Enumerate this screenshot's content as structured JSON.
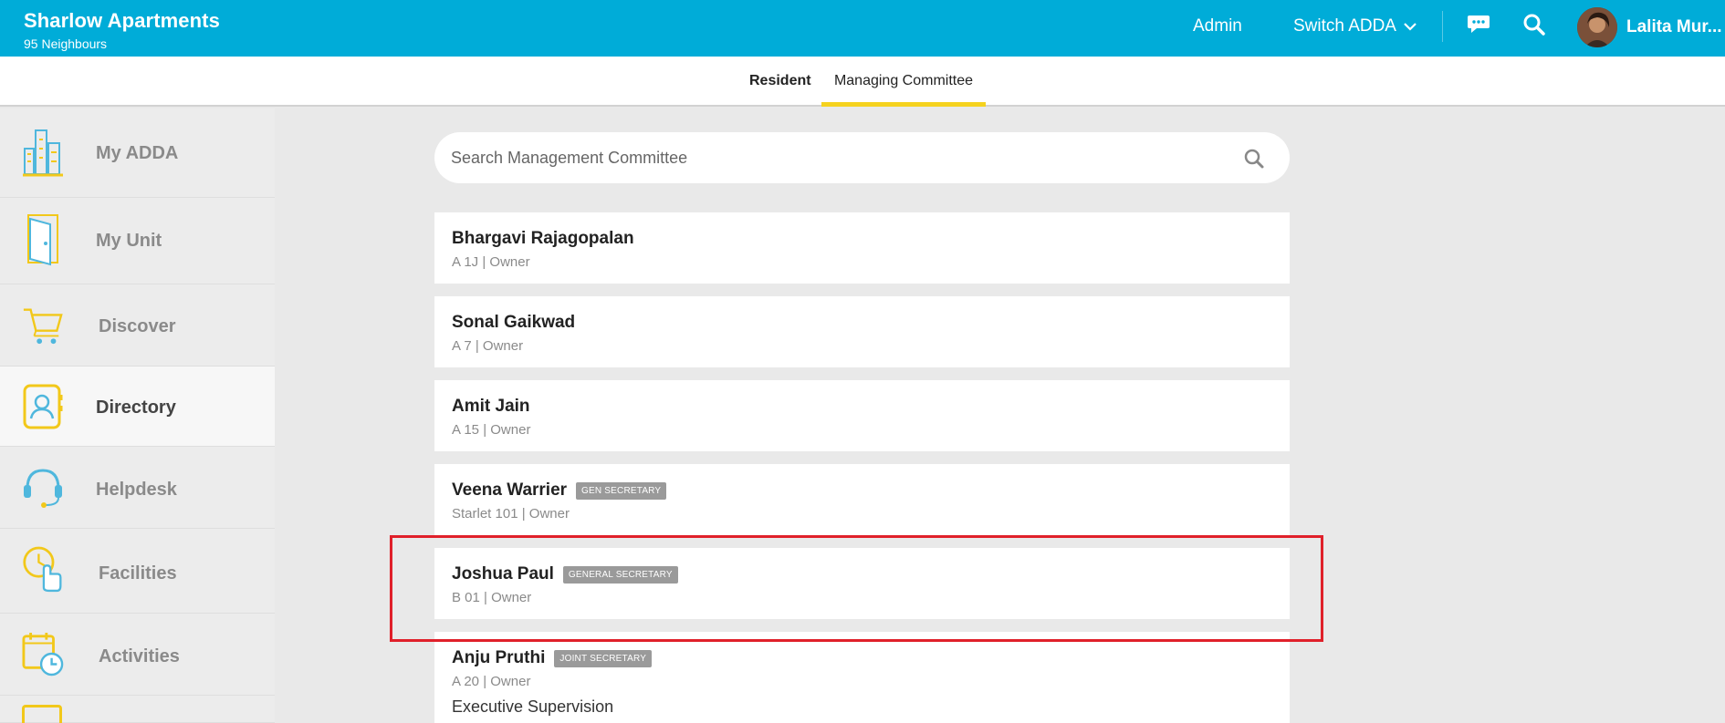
{
  "header": {
    "title": "Sharlow Apartments",
    "subtitle": "95 Neighbours",
    "admin_label": "Admin",
    "switch_label": "Switch ADDA",
    "user_name": "Lalita Mur...",
    "icons": [
      "chat-icon",
      "search-icon",
      "chevron-down-icon"
    ]
  },
  "tabs": [
    {
      "label": "Resident",
      "active": false
    },
    {
      "label": "Managing Committee",
      "active": true
    }
  ],
  "sidebar": {
    "items": [
      {
        "label": "My ADDA",
        "icon": "building-icon",
        "active": false
      },
      {
        "label": "My Unit",
        "icon": "door-icon",
        "active": false
      },
      {
        "label": "Discover",
        "icon": "cart-icon",
        "active": false
      },
      {
        "label": "Directory",
        "icon": "contact-book-icon",
        "active": true
      },
      {
        "label": "Helpdesk",
        "icon": "headset-icon",
        "active": false
      },
      {
        "label": "Facilities",
        "icon": "hand-click-icon",
        "active": false
      },
      {
        "label": "Activities",
        "icon": "calendar-clock-icon",
        "active": false
      }
    ]
  },
  "search": {
    "placeholder": "Search Management Committee"
  },
  "members": [
    {
      "name": "Bhargavi Rajagopalan",
      "badge": "",
      "detail": "A 1J | Owner",
      "extra": ""
    },
    {
      "name": "Sonal Gaikwad",
      "badge": "",
      "detail": "A 7 | Owner",
      "extra": ""
    },
    {
      "name": "Amit Jain",
      "badge": "",
      "detail": "A 15 | Owner",
      "extra": ""
    },
    {
      "name": "Veena Warrier",
      "badge": "GEN SECRETARY",
      "detail": "Starlet 101 | Owner",
      "extra": ""
    },
    {
      "name": "Joshua Paul",
      "badge": "GENERAL SECRETARY",
      "detail": "B 01 | Owner",
      "extra": ""
    },
    {
      "name": "Anju Pruthi",
      "badge": "JOINT SECRETARY",
      "detail": "A 20 | Owner",
      "extra": "Executive Supervision"
    }
  ],
  "colors": {
    "header_bg": "#00acd8",
    "tab_underline": "#f5d21e",
    "highlight_border": "#e0202a",
    "badge_bg": "#9a9a9a"
  }
}
